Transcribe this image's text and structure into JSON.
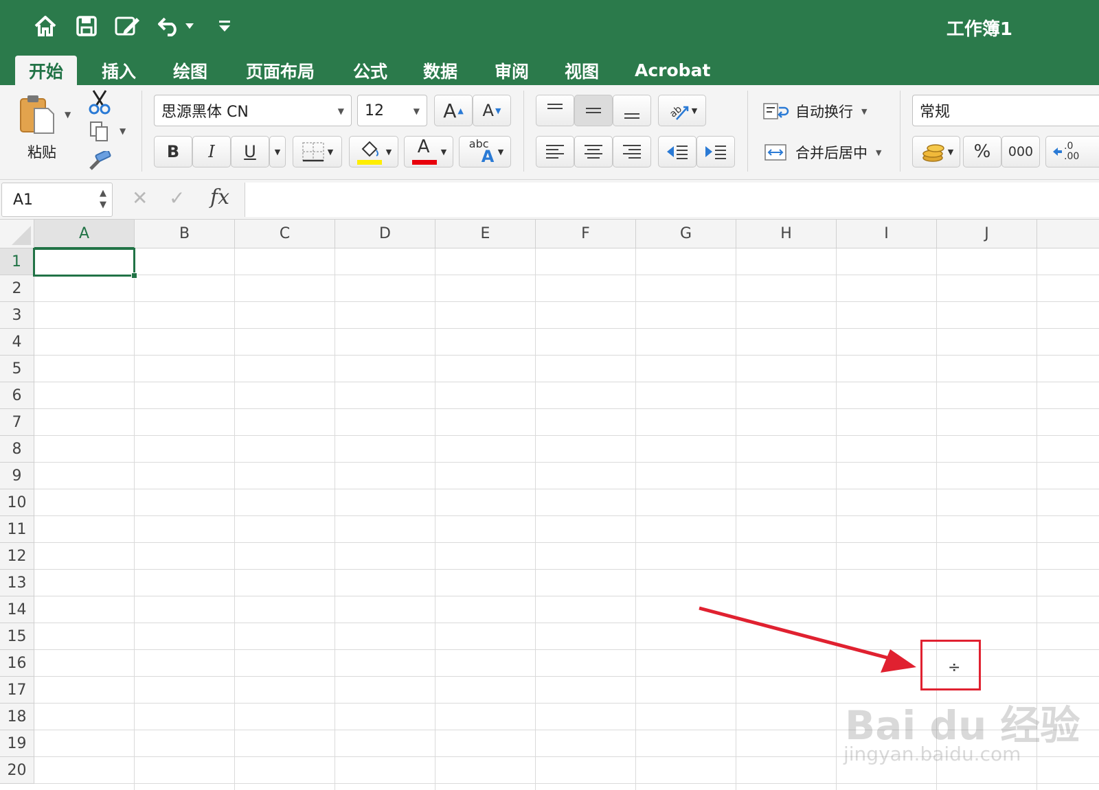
{
  "title_bar": {
    "workbook_title": "工作簿1",
    "icons": [
      "home-icon",
      "save-icon",
      "edit-icon",
      "undo-icon",
      "customize-icon"
    ]
  },
  "tabs": [
    {
      "label": "开始",
      "active": true
    },
    {
      "label": "插入",
      "active": false
    },
    {
      "label": "绘图",
      "active": false
    },
    {
      "label": "页面布局",
      "active": false
    },
    {
      "label": "公式",
      "active": false
    },
    {
      "label": "数据",
      "active": false
    },
    {
      "label": "审阅",
      "active": false
    },
    {
      "label": "视图",
      "active": false
    },
    {
      "label": "Acrobat",
      "active": false
    }
  ],
  "ribbon": {
    "paste_label": "粘贴",
    "font_name": "思源黑体 CN",
    "font_size": "12",
    "grow_font": "A",
    "shrink_font": "A",
    "bold": "B",
    "italic": "I",
    "underline": "U",
    "font_color_letter": "A",
    "phonetic_small": "abc",
    "phonetic_big": "A",
    "wrap_text": "自动换行",
    "merge_center": "合并后居中",
    "number_format": "常规",
    "percent": "%",
    "thousands": "000",
    "decimal_top": ".0",
    "decimal_bottom": ".00",
    "highlight_color": "#ffee00",
    "font_color": "#e8000b"
  },
  "formula_bar": {
    "name_box": "A1",
    "cancel": "✕",
    "enter": "✓",
    "fx": "fx",
    "content": ""
  },
  "sheet": {
    "columns": [
      "A",
      "B",
      "C",
      "D",
      "E",
      "F",
      "G",
      "H",
      "I",
      "J"
    ],
    "rows": [
      "1",
      "2",
      "3",
      "4",
      "5",
      "6",
      "7",
      "8",
      "9",
      "10",
      "11",
      "12",
      "13",
      "14",
      "15",
      "16",
      "17",
      "18",
      "19",
      "20"
    ],
    "active_cell": "A1",
    "cursor_glyph": "÷"
  },
  "annotation": {
    "arrow_color": "#e02130"
  },
  "watermark": {
    "brand": "Bai du 经验",
    "url": "jingyan.baidu.com"
  }
}
